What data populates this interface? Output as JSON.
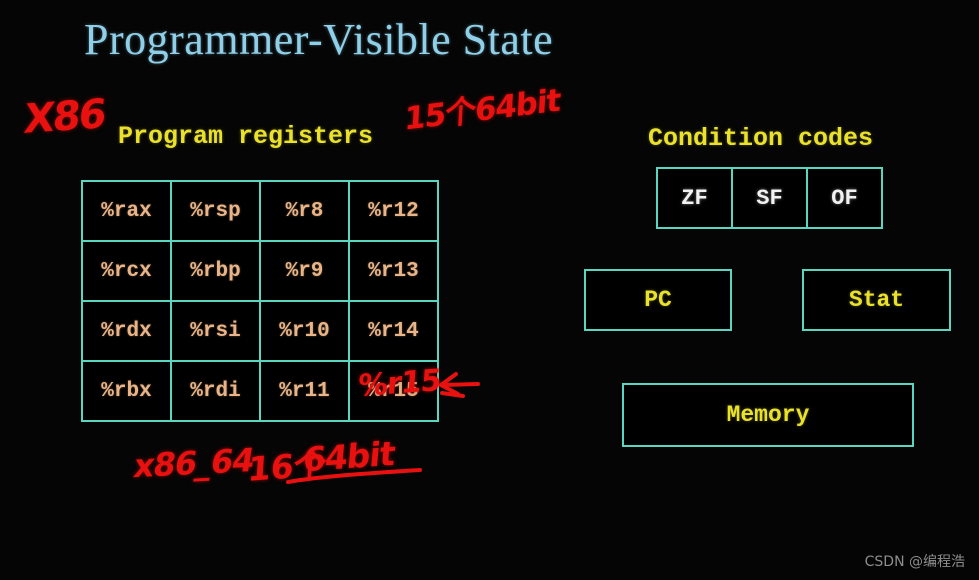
{
  "slide": {
    "title": "Programmer-Visible State",
    "title_color": "#8fcfe8",
    "background_color": "#050505",
    "box_border_color": "#59d6c0",
    "heading_color": "#eae22a",
    "register_text_color": "#e8b488",
    "flag_text_color": "#f2f2f2",
    "ink_color": "#e8110f"
  },
  "registers": {
    "label": "Program registers",
    "columns": [
      [
        "%rax",
        "%rcx",
        "%rdx",
        "%rbx"
      ],
      [
        "%rsp",
        "%rbp",
        "%rsi",
        "%rdi"
      ],
      [
        "%r8",
        "%r9",
        "%r10",
        "%r11"
      ],
      [
        "%r12",
        "%r13",
        "%r14",
        "%r15"
      ]
    ],
    "rows": [
      [
        "%rax",
        "%rsp",
        "%r8",
        "%r12"
      ],
      [
        "%rcx",
        "%rbp",
        "%r9",
        "%r13"
      ],
      [
        "%rdx",
        "%rsi",
        "%r10",
        "%r14"
      ],
      [
        "%rbx",
        "%rdi",
        "%r11",
        "%r15"
      ]
    ]
  },
  "condition_codes": {
    "label": "Condition codes",
    "flags": [
      "ZF",
      "SF",
      "OF"
    ]
  },
  "units": {
    "pc": "PC",
    "stat": "Stat",
    "memory": "Memory"
  },
  "annotations": {
    "x86": "X86",
    "fifteen_64bit": "15个64bit",
    "r15_overlay": "%r15",
    "x86_64": "x86_64",
    "sixteen_count": "16个",
    "sixtyfour_bit": "64bit"
  },
  "watermark": {
    "text": "CSDN @编程浩"
  }
}
